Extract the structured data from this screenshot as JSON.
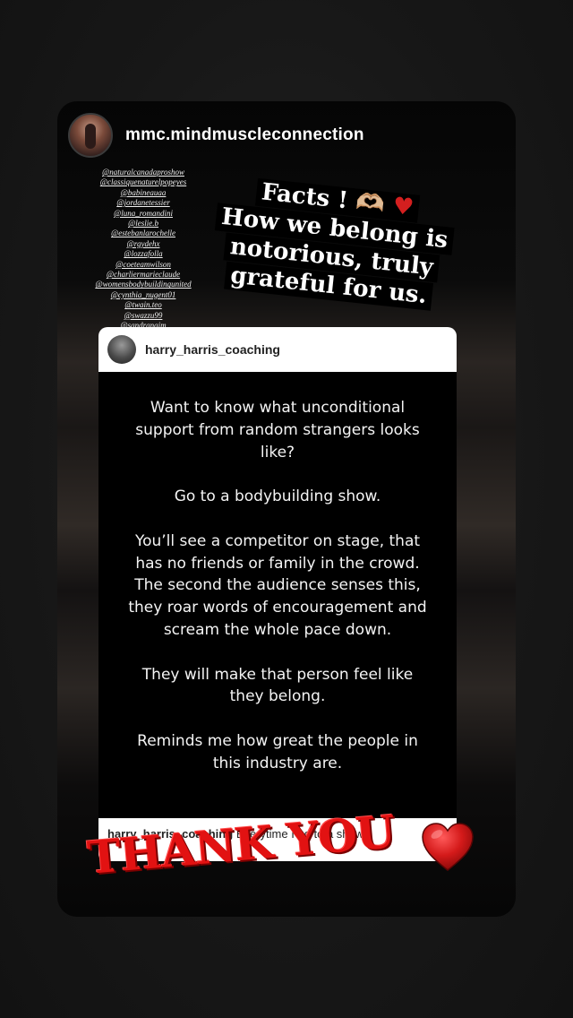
{
  "story": {
    "username": "mmc.mindmuscleconnection",
    "tags": [
      "@naturalcanadaproshow",
      "@classiquenaturelpopeyes",
      "@babineauaa",
      "@jordanetessier",
      "@luna_romandini",
      "@leslie.b",
      "@estebanlarochelle",
      "@rgydehx",
      "@lozzafolla",
      "@coeteamwilson",
      "@charliermarieclaude",
      "@womensbodybuildingunited",
      "@cynthia_nugent01",
      "@twain.teo",
      "@swazzu99",
      "@sandranaim"
    ],
    "sticker_line1": "Facts ! 🫶🏼",
    "sticker_heart": "♥",
    "sticker_lines": [
      "How we belong is",
      "notorious, truly",
      "grateful for us."
    ],
    "thank_you": "THANK YOU",
    "heart_icon": "heart-icon"
  },
  "post": {
    "handle": "harry_harris_coaching",
    "paragraphs": [
      "Want to know what unconditional support from random strangers looks like?",
      "Go to a bodybuilding show.",
      "You’ll see a competitor on stage, that has no friends or family in the crowd. The second the audience senses this, they roar words of encouragement and scream the whole pace down.",
      "They will make that person feel like they belong.",
      "Reminds me how great the people in this industry are."
    ],
    "comment_handle": "harry_harris_coaching",
    "comment_text": "Everytime I go to a show,"
  },
  "colors": {
    "background": "#161616",
    "accent_red": "#e21212",
    "card_body": "#000000",
    "card_header": "#ffffff"
  }
}
